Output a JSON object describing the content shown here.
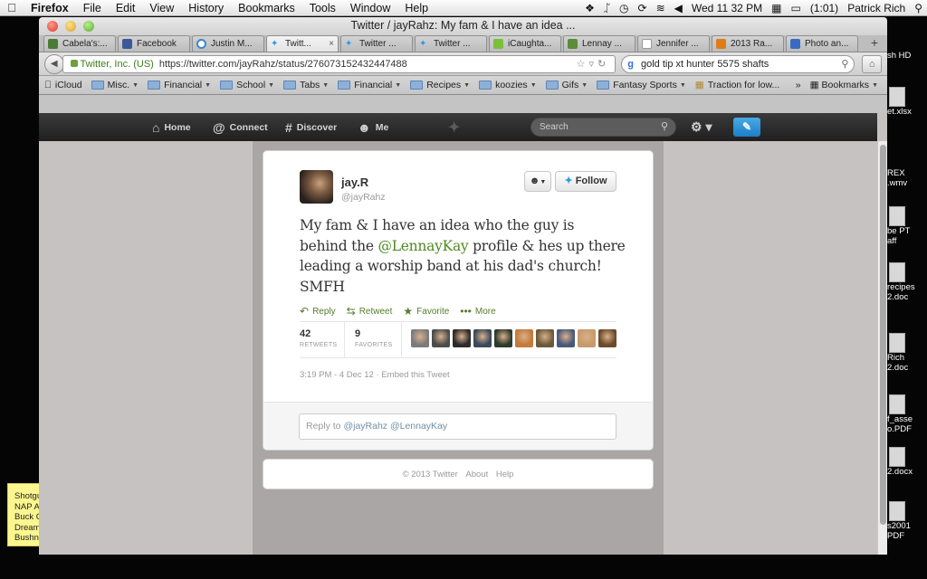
{
  "menubar": {
    "apple": "",
    "app": "Firefox",
    "items": [
      "File",
      "Edit",
      "View",
      "History",
      "Bookmarks",
      "Tools",
      "Window",
      "Help"
    ],
    "battery": "(1:01)",
    "clock": "Wed 11 32 PM",
    "user": "Patrick Rich"
  },
  "desktop": {
    "icons": [
      {
        "label": "sh HD"
      },
      {
        "label": "et.xlsx"
      },
      {
        "label": "REX\n.wmv"
      },
      {
        "label": "be PT\naff"
      },
      {
        "label": "recipes\n2.doc"
      },
      {
        "label": "Rich\n2.doc"
      },
      {
        "label": "f_asse\no.PDF"
      },
      {
        "label": "2.docx"
      },
      {
        "label": "s2001\nPDF"
      }
    ],
    "sticky": [
      "Shotgu",
      "NAP A",
      "Buck C",
      "Dream",
      "Bushn"
    ]
  },
  "window": {
    "title": "Twitter / jayRahz: My fam & I have an idea ...",
    "tabs": [
      {
        "label": "Cabela's:...",
        "color": "#4a7b36"
      },
      {
        "label": "Facebook",
        "color": "#3b5998"
      },
      {
        "label": "Justin M...",
        "color": "#ffffff"
      },
      {
        "label": "Twitt...",
        "color": "#2c9be0",
        "active": true
      },
      {
        "label": "Twitter ...",
        "color": "#2c9be0"
      },
      {
        "label": "Twitter ...",
        "color": "#2c9be0"
      },
      {
        "label": "iCaughta...",
        "color": "#7bbf3a"
      },
      {
        "label": "Lennay ...",
        "color": "#5a8c3a"
      },
      {
        "label": "Jennifer ...",
        "color": "#ffffff"
      },
      {
        "label": "2013 Ra...",
        "color": "#e07b1a"
      },
      {
        "label": "Photo an...",
        "color": "#3a6bc4"
      }
    ],
    "tab_close": "×",
    "new_tab": "+",
    "identity": "Twitter, Inc. (US)",
    "url": "https://twitter.com/jayRahz/status/276073152432447488",
    "search_query": "gold tip xt hunter 5575 shafts",
    "bookmarks": [
      {
        "label": "iCloud",
        "folder": false
      },
      {
        "label": "Misc.",
        "folder": true
      },
      {
        "label": "Financial",
        "folder": true
      },
      {
        "label": "School",
        "folder": true
      },
      {
        "label": "Tabs",
        "folder": true
      },
      {
        "label": "Financial",
        "folder": true
      },
      {
        "label": "Recipes",
        "folder": true
      },
      {
        "label": "koozies",
        "folder": true
      },
      {
        "label": "Gifs",
        "folder": true
      },
      {
        "label": "Fantasy Sports",
        "folder": true
      },
      {
        "label": "Traction for low...",
        "folder": false
      }
    ],
    "bookmarks_overflow": "»",
    "bookmarks_menu": "Bookmarks"
  },
  "twitter_nav": {
    "home": "Home",
    "connect": "Connect",
    "discover": "Discover",
    "me": "Me",
    "search_placeholder": "Search"
  },
  "tweet": {
    "display_name": "jay.R",
    "handle": "@jayRahz",
    "follow_label": "Follow",
    "text_parts": {
      "a": "My fam & I have an idea who the guy is behind the ",
      "mention": "@LennayKay",
      "b": " profile & hes up there leading a worship band at his dad's church! SMFH"
    },
    "actions": {
      "reply": "Reply",
      "retweet": "Retweet",
      "favorite": "Favorite",
      "more": "More"
    },
    "stats": {
      "retweets": "42",
      "retweets_label": "RETWEETS",
      "favorites": "9",
      "favorites_label": "FAVORITES"
    },
    "favoriter_colors": [
      "#7b7b7b",
      "#4c4c4c",
      "#2b2b2b",
      "#3a4a5a",
      "#2e3a2a",
      "#c47a3a",
      "#6a5a3a",
      "#4a5a7a",
      "#c89a6a",
      "#6a4a2a"
    ],
    "timestamp": "3:19 PM - 4 Dec 12",
    "separator": "·",
    "embed": "Embed this Tweet",
    "reply_prefix": "Reply to ",
    "reply_mentions": "@jayRahz @LennayKay"
  },
  "footer": {
    "copyright": "© 2013 Twitter",
    "about": "About",
    "help": "Help"
  }
}
